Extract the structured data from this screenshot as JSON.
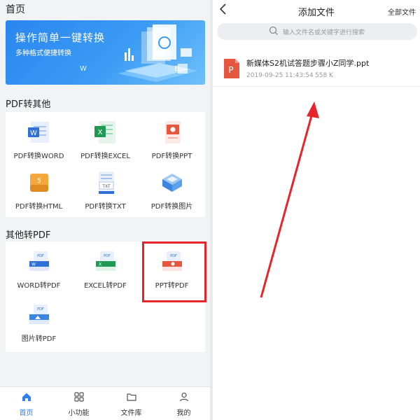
{
  "left": {
    "home_title": "首页",
    "banner": {
      "title": "操作简单一键转换",
      "subtitle": "多种格式便捷转换",
      "w_mark": "W",
      "e_mark": "E"
    },
    "section1": {
      "title": "PDF转其他",
      "items": [
        {
          "label": "PDF转换WORD",
          "icon": "word-doc-icon"
        },
        {
          "label": "PDF转换EXCEL",
          "icon": "excel-doc-icon"
        },
        {
          "label": "PDF转换PPT",
          "icon": "ppt-doc-icon"
        },
        {
          "label": "PDF转换HTML",
          "icon": "html-doc-icon"
        },
        {
          "label": "PDF转换TXT",
          "icon": "txt-doc-icon"
        },
        {
          "label": "PDF转换图片",
          "icon": "image-doc-icon"
        }
      ]
    },
    "section2": {
      "title": "其他转PDF",
      "items": [
        {
          "label": "WORD转PDF",
          "icon": "word-to-pdf-icon"
        },
        {
          "label": "EXCEL转PDF",
          "icon": "excel-to-pdf-icon"
        },
        {
          "label": "PPT转PDF",
          "icon": "ppt-to-pdf-icon"
        },
        {
          "label": "图片转PDF",
          "icon": "image-to-pdf-icon"
        }
      ]
    },
    "tabs": [
      {
        "label": "首页",
        "icon": "home-icon",
        "active": true
      },
      {
        "label": "小功能",
        "icon": "grid-icon",
        "active": false
      },
      {
        "label": "文件库",
        "icon": "folder-icon",
        "active": false
      },
      {
        "label": "我的",
        "icon": "user-icon",
        "active": false
      }
    ]
  },
  "right": {
    "title": "添加文件",
    "all_files": "全部文件",
    "search_placeholder": "输入文件名或关键字进行搜索",
    "files": [
      {
        "name": "新媒体S2机试答题步骤小Z同学.ppt",
        "date": "2019-09-25 11:43:54",
        "size": "558 K"
      }
    ]
  },
  "colors": {
    "accent": "#2f80ed",
    "highlight": "#e5242b",
    "ppt": "#e5573f"
  }
}
